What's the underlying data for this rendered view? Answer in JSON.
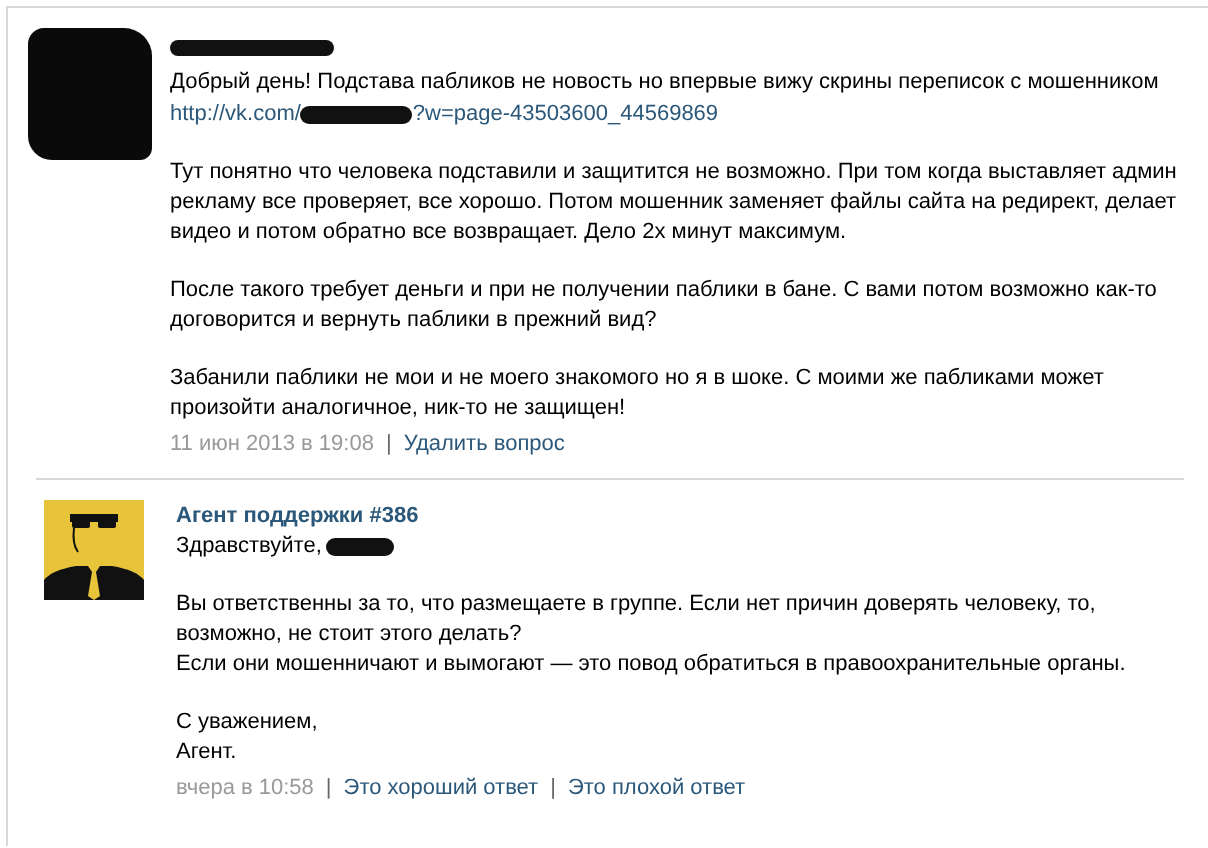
{
  "question": {
    "intro": "Добрый день! Подстава пабликов не новость но впервые вижу скрины переписок с мошенником",
    "link": {
      "prefix": "http://vk.com/",
      "suffix": "?w=page-43503600_44569869"
    },
    "paragraphs": [
      "Тут понятно что человека подставили и защитится не возможно. При том когда выставляет админ рекламу все проверяет, все хорошо. Потом мошенник заменяет файлы сайта на редирект, делает видео и потом обратно все возвращает. Дело 2х минут максимум.",
      "После такого требует деньги и при не получении паблики в бане. С вами потом возможно как-то договорится и вернуть паблики в прежний вид?",
      "Забанили паблики не мои и не моего знакомого но я в шоке. С моими же пабликами может произойти аналогичное, ник-то не защищен!"
    ],
    "footer": [
      {
        "kind": "time",
        "text": "11 июн 2013 в 19:08"
      },
      {
        "kind": "sep",
        "text": "|"
      },
      {
        "kind": "link",
        "text": "Удалить вопрос"
      }
    ]
  },
  "answer": {
    "author": "Агент поддержки #386",
    "greeting": "Здравствуйте,",
    "blocks": [
      [
        "Вы ответственны за то, что размещаете в группе. Если нет причин доверять человеку, то, возможно, не стоит этого делать?",
        "Если они мошенничают и вымогают — это повод обратиться в правоохранительные органы."
      ],
      [
        "С уважением,",
        "Агент."
      ]
    ],
    "footer": [
      {
        "kind": "time",
        "text": "вчера в 10:58"
      },
      {
        "kind": "sep",
        "text": "|"
      },
      {
        "kind": "link",
        "text": "Это хороший ответ"
      },
      {
        "kind": "sep",
        "text": "|"
      },
      {
        "kind": "link",
        "text": "Это плохой ответ"
      }
    ]
  }
}
